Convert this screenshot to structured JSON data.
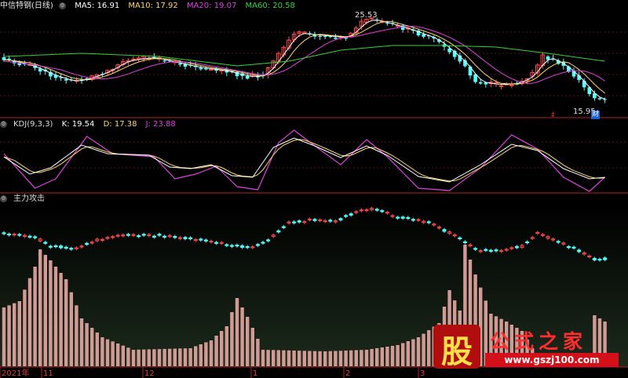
{
  "header": {
    "title": "中信特钢(日线)",
    "ma5": "MA5: 16.91",
    "ma10": "MA10: 17.92",
    "ma20": "MA20: 19.07",
    "ma60": "MA60: 20.58",
    "kdj_label": "KDJ(9,3,3)",
    "kdj_k": "K: 19.54",
    "kdj_d": "D: 17.38",
    "kdj_j": "J: 23.88",
    "indicator_title": "主力攻击"
  },
  "annotations": {
    "high_label": "25.53",
    "low_label": "15.95",
    "marker_label": "财"
  },
  "xaxis": {
    "labels": [
      "2021年",
      "11",
      "12",
      "1",
      "2",
      "3"
    ]
  },
  "watermark": {
    "brand": "公式之家",
    "logo_char": "股",
    "url": "www.gszj100.com"
  },
  "colors": {
    "up": "#ff4a4a",
    "down": "#54ffff",
    "ma5": "#ffffff",
    "ma10": "#ffd86a",
    "ma20": "#e040e0",
    "ma60": "#34d434"
  },
  "chart_data": {
    "type": "candlestick",
    "price_high": 25.53,
    "price_low": 15.95,
    "ma": {
      "MA5": 16.91,
      "MA10": 17.92,
      "MA20": 19.07,
      "MA60": 20.58
    },
    "kdj": {
      "K": 19.54,
      "D": 17.38,
      "J": 23.88
    },
    "x_labels": [
      "2021年",
      "11",
      "12",
      "1",
      "2",
      "3"
    ]
  }
}
